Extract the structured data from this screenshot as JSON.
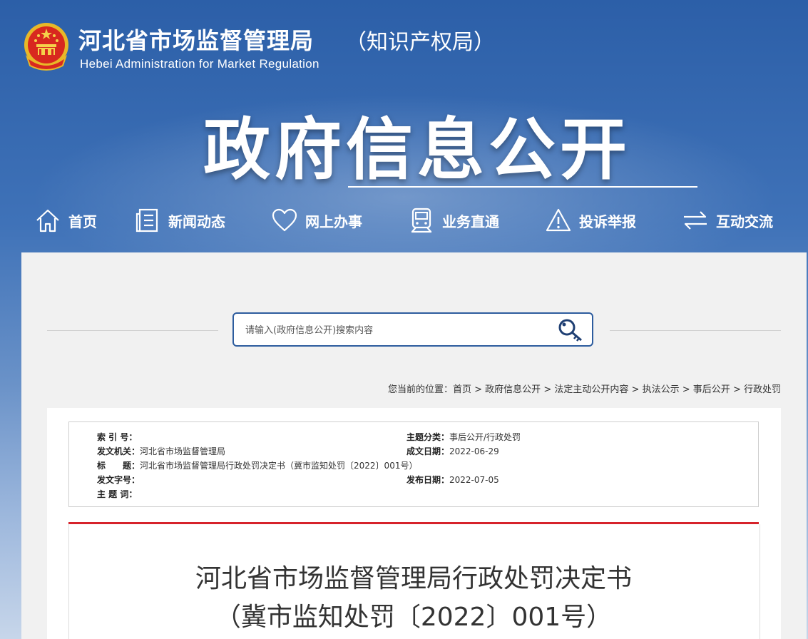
{
  "header": {
    "site_name": "河北省市场监督管理局",
    "site_sub": "（知识产权局）",
    "site_en": "Hebei Administration for Market Regulation",
    "banner_title": "政府信息公开"
  },
  "nav": {
    "items": [
      {
        "label": "首页",
        "icon": "home-icon"
      },
      {
        "label": "新闻动态",
        "icon": "news-icon"
      },
      {
        "label": "网上办事",
        "icon": "heart-icon"
      },
      {
        "label": "业务直通",
        "icon": "train-icon"
      },
      {
        "label": "投诉举报",
        "icon": "warning-icon"
      },
      {
        "label": "互动交流",
        "icon": "exchange-icon"
      }
    ]
  },
  "search": {
    "placeholder": "请输入(政府信息公开)搜索内容",
    "icon": "search-key-icon"
  },
  "breadcrumb": {
    "prefix": "您当前的位置：",
    "items": [
      "首页",
      "政府信息公开",
      "法定主动公开内容",
      "执法公示",
      "事后公开",
      "行政处罚"
    ],
    "separator": ">"
  },
  "meta": {
    "index_label": "索 引 号：",
    "index_value": "",
    "issuer_label": "发文机关：",
    "issuer_value": "河北省市场监督管理局",
    "title_label": "标　　题：",
    "title_value": "河北省市场监督管理局行政处罚决定书（冀市监知处罚〔2022〕001号）",
    "docno_label": "发文字号：",
    "docno_value": "",
    "keywords_label": "主 题 词：",
    "keywords_value": "",
    "category_label": "主题分类：",
    "category_value": "事后公开/行政处罚",
    "created_label": "成文日期：",
    "created_value": "2022-06-29",
    "published_label": "发布日期：",
    "published_value": "2022-07-05"
  },
  "document": {
    "title": "河北省市场监督管理局行政处罚决定书",
    "number": "（冀市监知处罚〔2022〕001号）"
  },
  "colors": {
    "primary_blue": "#2d5c9e",
    "accent_red": "#d6232b",
    "panel_bg": "#f1f1f1"
  }
}
